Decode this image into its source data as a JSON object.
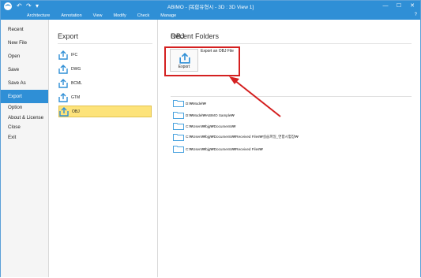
{
  "window": {
    "title": "ABIMO - [복합유형시 - 3D : 3D View 1]",
    "controls": [
      "—",
      "☐",
      "✕"
    ]
  },
  "menubar": {
    "tabs": [
      "Architecture",
      "Annotation",
      "View",
      "Modify",
      "Check",
      "Manage"
    ],
    "help": "?"
  },
  "sidebar": {
    "items": [
      {
        "label": "Recent"
      },
      {
        "label": "New File"
      },
      {
        "label": "Open"
      },
      {
        "label": "Save"
      },
      {
        "label": "Save As"
      },
      {
        "label": "Export"
      },
      {
        "label": "Option"
      },
      {
        "label": "About & License"
      },
      {
        "label": "Close"
      },
      {
        "label": "Exit"
      }
    ],
    "selected": "Export"
  },
  "export_panel": {
    "heading": "Export",
    "formats": [
      {
        "label": "IFC"
      },
      {
        "label": "DWG"
      },
      {
        "label": "BCML"
      },
      {
        "label": "GTM"
      },
      {
        "label": "OBJ"
      }
    ],
    "selected": "OBJ"
  },
  "content": {
    "heading": "OBJ",
    "export_button_label": "Export",
    "export_description": "Export an OBJ File",
    "recent_heading": "Recent Folders",
    "recent_folders": [
      {
        "path": "D:₩Model₩"
      },
      {
        "path": "D:₩Model₩ABIMO Sample₩"
      },
      {
        "path": "C:₩Users₩bjg₩Documents₩"
      },
      {
        "path": "C:₩Users₩bjg₩Documents₩Received Files₩실습파일_연합시험장₩"
      },
      {
        "path": "C:₩Users₩bjg₩Documents₩Received Files₩"
      }
    ]
  },
  "colors": {
    "accent": "#2f8fd6",
    "highlight_border": "#d42020",
    "selected_format_bg": "#fde37a",
    "folder": "#4aa3df"
  },
  "icons": {
    "export": "export-arrow-up-icon",
    "folder": "folder-icon"
  }
}
